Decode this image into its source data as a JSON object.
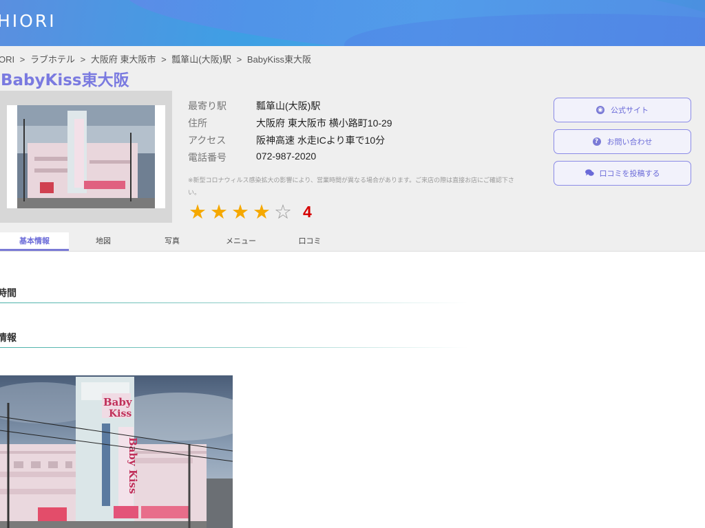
{
  "header": {
    "logo": "HIORI"
  },
  "breadcrumb": {
    "items": [
      "ORI",
      "ラブホテル",
      "大阪府 東大阪市",
      "瓢箪山(大阪)駅",
      "BabyKiss東大阪"
    ],
    "separator": ">"
  },
  "hotel": {
    "title": "BabyKiss東大阪",
    "details": [
      {
        "label": "最寄り駅",
        "value": "瓢箪山(大阪)駅"
      },
      {
        "label": "住所",
        "value": "大阪府 東大阪市 横小路町10-29"
      },
      {
        "label": "アクセス",
        "value": "阪神高速 水走ICより車で10分"
      },
      {
        "label": "電話番号",
        "value": "072-987-2020"
      }
    ],
    "notice": "※新型コロナウィルス感染拡大の影響により、営業時間が異なる場合があります。ご来店の際は直接お店にご確認下さい。",
    "rating": {
      "value": "4",
      "stars_filled": 4,
      "stars_total": 5
    },
    "sign_text": "Baby Kiss"
  },
  "actions": {
    "official_site": "公式サイト",
    "contact": "お問い合わせ",
    "post_review": "口コミを投稿する"
  },
  "tabs": [
    "基本情報",
    "地図",
    "写真",
    "メニュー",
    "口コミ"
  ],
  "sections": {
    "hours": "時間",
    "info": "情報"
  },
  "colors": {
    "accent": "#7a7ad6",
    "rating_star": "#f5a800",
    "rating_number": "#d60000",
    "header_blue": "#45a6e6"
  }
}
